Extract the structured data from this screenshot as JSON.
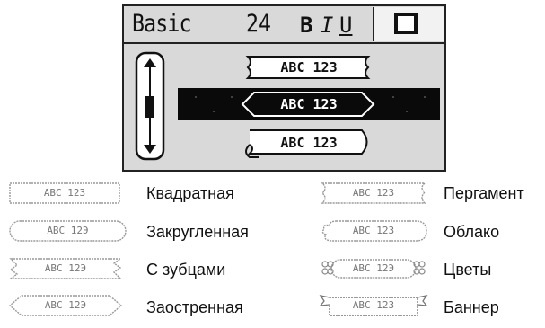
{
  "lcd": {
    "font_name": "Basic",
    "font_size": "24",
    "style_bold": "B",
    "style_italic": "I",
    "style_underline": "U",
    "frame_icon": "square-frame-icon",
    "list": [
      {
        "text": "ABC 123",
        "frame": "parchment",
        "selected": false
      },
      {
        "text": "ABC 123",
        "frame": "pointed",
        "selected": true
      },
      {
        "text": "ABC 123",
        "frame": "scroll",
        "selected": false
      }
    ]
  },
  "legend": [
    {
      "sample": "ABC 123",
      "label": "Квадратная",
      "frame": "square-frame-icon"
    },
    {
      "sample": "ABC 12Э",
      "label": "Закругленная",
      "frame": "rounded-frame-icon"
    },
    {
      "sample": "ABC 12Э",
      "label": "С зубцами",
      "frame": "zigzag-frame-icon"
    },
    {
      "sample": "ABC 12Э",
      "label": "Заостренная",
      "frame": "pointed-frame-icon"
    },
    {
      "sample": "ABC 123",
      "label": "Пергамент",
      "frame": "parchment-frame-icon"
    },
    {
      "sample": "ABC 123",
      "label": "Облако",
      "frame": "cloud-frame-icon"
    },
    {
      "sample": "ABC 12Э",
      "label": "Цветы",
      "frame": "flowers-frame-icon"
    },
    {
      "sample": "ABC 123",
      "label": "Баннер",
      "frame": "banner-frame-icon"
    }
  ]
}
